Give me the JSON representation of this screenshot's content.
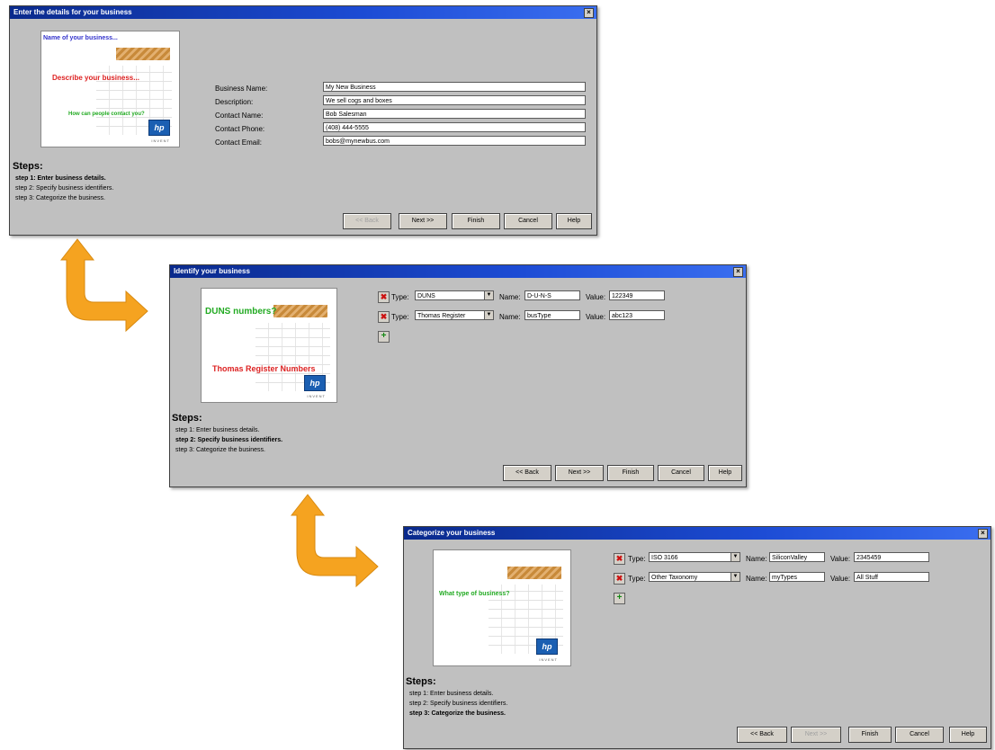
{
  "colors": {
    "accent_arrow": "#f5a320",
    "title_bar": "#1c4bd4"
  },
  "window1": {
    "title": "Enter the details for your business",
    "banner": {
      "line1": "Name of your business...",
      "line2": "Describe your business...",
      "line3": "How can people contact you?",
      "logo": "hp",
      "logo_sub": "INVENT"
    },
    "fields": [
      {
        "label": "Business Name:",
        "value": "My New Business"
      },
      {
        "label": "Description:",
        "value": "We sell cogs and boxes"
      },
      {
        "label": "Contact Name:",
        "value": "Bob Salesman"
      },
      {
        "label": "Contact Phone:",
        "value": "(408) 444-5555"
      },
      {
        "label": "Contact Email:",
        "value": "bobs@mynewbus.com"
      }
    ],
    "steps_title": "Steps:",
    "steps": [
      "step 1: Enter business details.",
      "step 2: Specify business identifiers.",
      "step 3: Categorize the business."
    ],
    "buttons": {
      "back": "<< Back",
      "next": "Next >>",
      "finish": "Finish",
      "cancel": "Cancel",
      "help": "Help"
    }
  },
  "window2": {
    "title": "Identify your business",
    "banner": {
      "line1": "DUNS numbers?",
      "line2": "Thomas Register Numbers",
      "logo": "hp",
      "logo_sub": "INVENT"
    },
    "rows": [
      {
        "type_label": "Type:",
        "type": "DUNS",
        "name_label": "Name:",
        "name": "D-U-N-S",
        "value_label": "Value:",
        "value": "122349"
      },
      {
        "type_label": "Type:",
        "type": "Thomas Register",
        "name_label": "Name:",
        "name": "busType",
        "value_label": "Value:",
        "value": "abc123"
      }
    ],
    "steps_title": "Steps:",
    "steps": [
      "step 1: Enter business details.",
      "step 2: Specify business identifiers.",
      "step 3: Categorize the business."
    ],
    "buttons": {
      "back": "<< Back",
      "next": "Next >>",
      "finish": "Finish",
      "cancel": "Cancel",
      "help": "Help"
    }
  },
  "window3": {
    "title": "Categorize your business",
    "banner": {
      "line1": "What type of business?",
      "logo": "hp",
      "logo_sub": "INVENT"
    },
    "rows": [
      {
        "type_label": "Type:",
        "type": "ISO 3166",
        "name_label": "Name:",
        "name": "SiliconValley",
        "value_label": "Value:",
        "value": "2345459"
      },
      {
        "type_label": "Type:",
        "type": "Other Taxonomy",
        "name_label": "Name:",
        "name": "myTypes",
        "value_label": "Value:",
        "value": "All Stuff"
      }
    ],
    "steps_title": "Steps:",
    "steps": [
      "step 1: Enter business details.",
      "step 2: Specify business identifiers.",
      "step 3: Categorize the business."
    ],
    "buttons": {
      "back": "<< Back",
      "next": "Next >>",
      "finish": "Finish",
      "cancel": "Cancel",
      "help": "Help"
    }
  }
}
